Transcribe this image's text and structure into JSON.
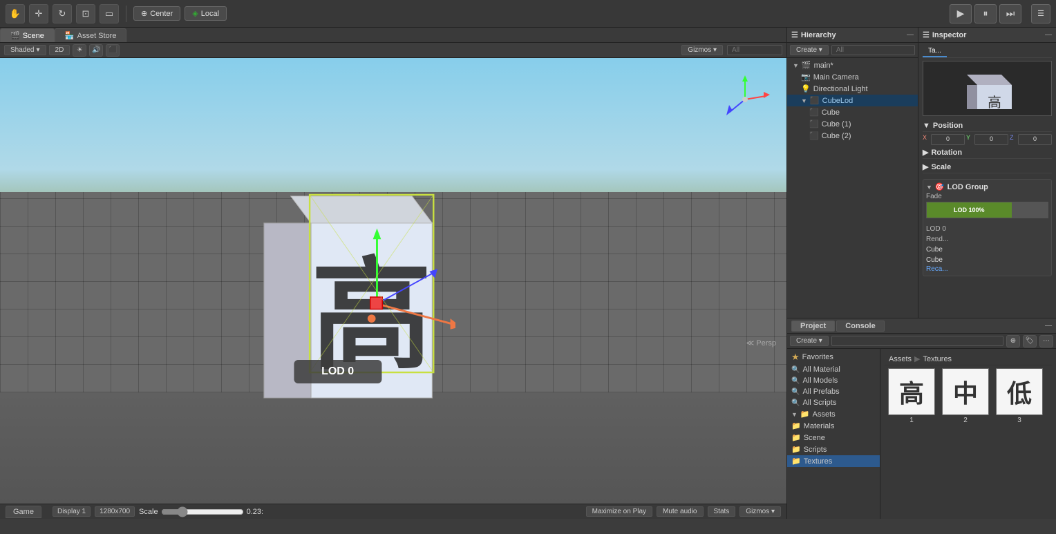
{
  "toolbar": {
    "transform_tools": [
      "hand",
      "move",
      "rotate",
      "scale",
      "rect"
    ],
    "center_label": "Center",
    "local_label": "Local",
    "play_btn": "▶",
    "pause_btn": "⏸",
    "step_btn": "⏭",
    "top_right_icon": "☰"
  },
  "tabs": {
    "scene_label": "Scene",
    "asset_store_label": "Asset Store"
  },
  "scene_toolbar": {
    "shading_label": "Shaded",
    "two_d_label": "2D",
    "gizmos_label": "Gizmos ▾",
    "search_placeholder": "All"
  },
  "viewport": {
    "lod_label": "LOD 0",
    "persp_label": "≪ Persp"
  },
  "hierarchy": {
    "title": "Hierarchy",
    "create_label": "Create ▾",
    "search_placeholder": "All",
    "items": [
      {
        "label": "main*",
        "indent": 0,
        "type": "scene",
        "expanded": true
      },
      {
        "label": "Main Camera",
        "indent": 1,
        "type": "camera"
      },
      {
        "label": "Directional Light",
        "indent": 1,
        "type": "light"
      },
      {
        "label": "CubeLod",
        "indent": 1,
        "type": "object",
        "expanded": true,
        "selected": true
      },
      {
        "label": "Cube",
        "indent": 2,
        "type": "cube"
      },
      {
        "label": "Cube (1)",
        "indent": 2,
        "type": "cube"
      },
      {
        "label": "Cube (2)",
        "indent": 2,
        "type": "cube"
      }
    ]
  },
  "inspector": {
    "title": "Inspector",
    "tabs": [
      "Ta..."
    ],
    "transform": {
      "position_label": "Position",
      "rotation_label": "Rotation",
      "scale_label": "Scale",
      "position": {
        "x": "",
        "y": "",
        "z": ""
      },
      "rotation": {
        "x": "",
        "y": "",
        "z": ""
      },
      "scale": {
        "x": "",
        "y": "",
        "z": ""
      }
    },
    "lod_group": {
      "title": "LOD Group",
      "fade_label": "Fade",
      "lod_bars": [
        {
          "label": "LOD 100%",
          "color": "#5a8a2a"
        }
      ],
      "lod_entries": [
        {
          "label": "LOD 0"
        },
        {
          "label": "Rend..."
        }
      ],
      "recalc_label": "Reca..."
    },
    "cube_items": [
      {
        "label": "Cube"
      },
      {
        "label": "Cube"
      }
    ]
  },
  "project": {
    "title": "Project",
    "console_label": "Console",
    "create_label": "Create ▾",
    "favorites": {
      "label": "Favorites",
      "items": [
        "All Material",
        "All Models",
        "All Prefabs",
        "All Scripts"
      ]
    },
    "assets": {
      "label": "Assets",
      "items": [
        "Materials",
        "Scene",
        "Scripts",
        "Textures"
      ]
    },
    "breadcrumb": {
      "assets": "Assets",
      "sep": "▶",
      "textures": "Textures"
    },
    "textures": [
      {
        "name": "1",
        "char": "高",
        "selected": false
      },
      {
        "name": "2",
        "char": "中",
        "selected": false
      },
      {
        "name": "3",
        "char": "低",
        "selected": false
      }
    ]
  },
  "game_bar": {
    "game_label": "Game",
    "display_label": "Display 1",
    "resolution_label": "1280x700",
    "scale_label": "Scale",
    "scale_value": "0.23:",
    "maximize_label": "Maximize on Play",
    "mute_label": "Mute audio",
    "stats_label": "Stats",
    "gizmos_label": "Gizmos ▾"
  }
}
